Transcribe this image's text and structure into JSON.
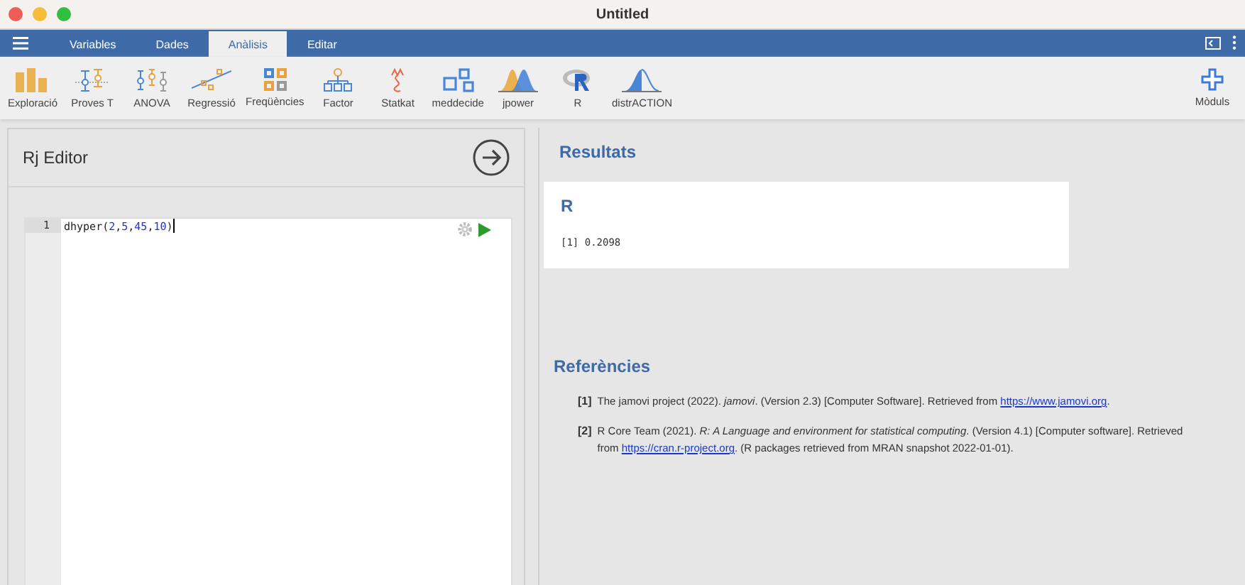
{
  "window": {
    "title": "Untitled"
  },
  "tabs": [
    {
      "label": "Variables",
      "selected": false
    },
    {
      "label": "Dades",
      "selected": false
    },
    {
      "label": "Anàlisis",
      "selected": true
    },
    {
      "label": "Editar",
      "selected": false
    }
  ],
  "toolbar": [
    {
      "label": "Exploració",
      "kind": "bars"
    },
    {
      "label": "Proves T",
      "kind": "ttest"
    },
    {
      "label": "ANOVA",
      "kind": "anova"
    },
    {
      "label": "Regressió",
      "kind": "regression"
    },
    {
      "label": "Freqüències",
      "kind": "grid"
    },
    {
      "label": "Factor",
      "kind": "tree"
    },
    {
      "label": "Statkat",
      "kind": "squiggle"
    },
    {
      "label": "meddecide",
      "kind": "squares"
    },
    {
      "label": "jpower",
      "kind": "peaks"
    },
    {
      "label": "R",
      "kind": "rlogo"
    },
    {
      "label": "distrACTION",
      "kind": "bell"
    }
  ],
  "modules_button": {
    "label": "Mòduls"
  },
  "editor": {
    "title": "Rj Editor",
    "lines": [
      {
        "number": "1",
        "tokens": [
          {
            "kind": "name",
            "text": "dhyper"
          },
          {
            "kind": "punct",
            "text": "("
          },
          {
            "kind": "num",
            "text": "2"
          },
          {
            "kind": "punct",
            "text": ","
          },
          {
            "kind": "num",
            "text": "5"
          },
          {
            "kind": "punct",
            "text": ","
          },
          {
            "kind": "num",
            "text": "45"
          },
          {
            "kind": "punct",
            "text": ","
          },
          {
            "kind": "num",
            "text": "10"
          },
          {
            "kind": "punct",
            "text": ")"
          }
        ]
      }
    ]
  },
  "results": {
    "title": "Resultats",
    "card": {
      "heading": "R",
      "output": "[1] 0.2098"
    },
    "references_title": "Referències",
    "references": [
      {
        "number": "[1]",
        "before": "The jamovi project (2022). *jamovi*. (Version 2.3) [Computer Software]. Retrieved from ",
        "link": "https://www.jamovi.org",
        "after": "."
      },
      {
        "number": "[2]",
        "before": "R Core Team (2021). *R: A Language and environment for statistical computing*. (Version 4.1) [Computer software]. Retrieved from ",
        "link": "https://cran.r-project.org",
        "after": ". (R packages retrieved from MRAN snapshot 2022-01-01)."
      }
    ]
  }
}
